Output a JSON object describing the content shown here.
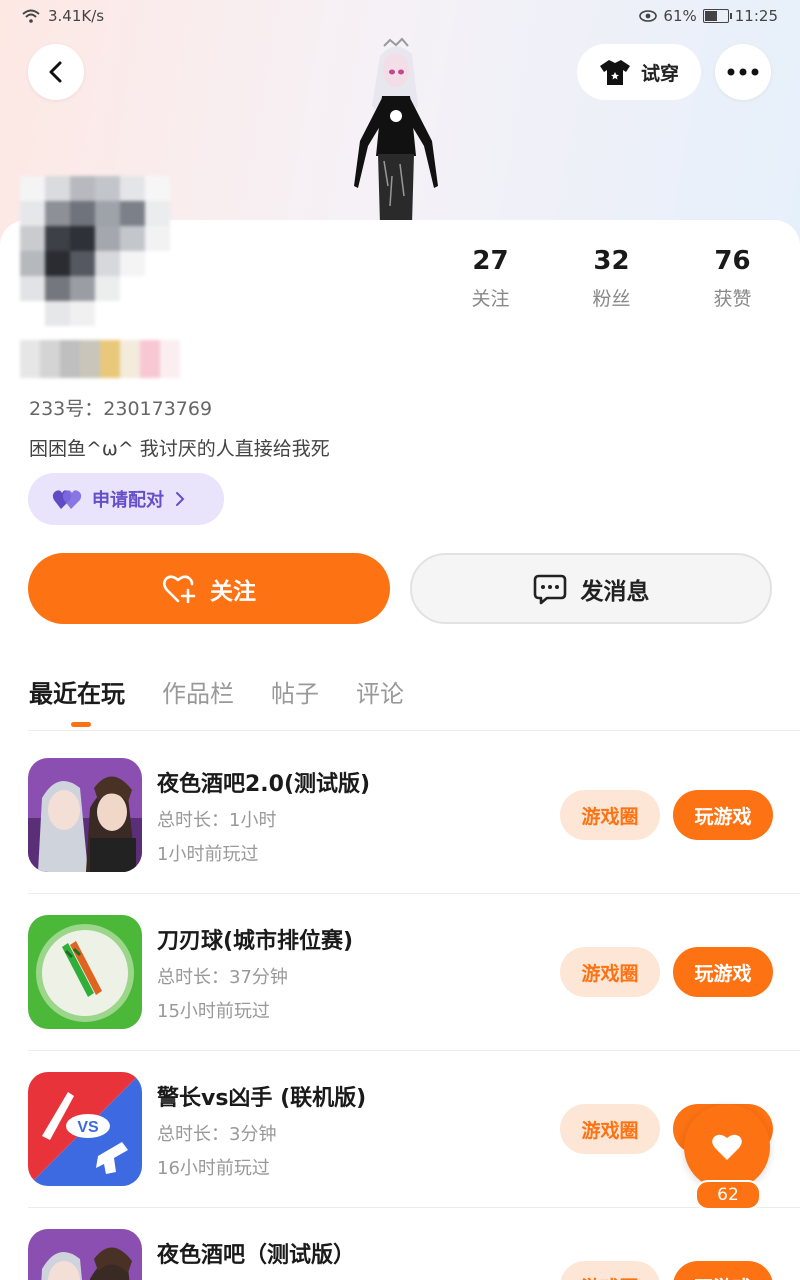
{
  "status_bar": {
    "network_speed": "3.41K/s",
    "battery_percent": "61%",
    "battery_level": 0.61,
    "time": "11:25"
  },
  "header": {
    "try_on_label": "试穿"
  },
  "profile": {
    "stats": [
      {
        "value": "27",
        "label": "关注"
      },
      {
        "value": "32",
        "label": "粉丝"
      },
      {
        "value": "76",
        "label": "获赞"
      }
    ],
    "uid": "233号：230173769",
    "bio": "困困鱼^ω^  我讨厌的人直接给我死",
    "pair_label": "申请配对"
  },
  "actions": {
    "follow_label": "关注",
    "message_label": "发消息"
  },
  "tabs": [
    {
      "label": "最近在玩",
      "active": true
    },
    {
      "label": "作品栏",
      "active": false
    },
    {
      "label": "帖子",
      "active": false
    },
    {
      "label": "评论",
      "active": false
    }
  ],
  "games": [
    {
      "title": "夜色酒吧2.0(测试版)",
      "duration": "总时长：1小时",
      "last_played": "1小时前玩过",
      "circle_label": "游戏圈",
      "play_label": "玩游戏"
    },
    {
      "title": "刀刃球(城市排位赛)",
      "duration": "总时长：37分钟",
      "last_played": "15小时前玩过",
      "circle_label": "游戏圈",
      "play_label": "玩游戏"
    },
    {
      "title": "警长vs凶手 (联机版)",
      "duration": "总时长：3分钟",
      "last_played": "16小时前玩过",
      "circle_label": "游戏圈",
      "play_label": "玩游戏"
    },
    {
      "title": "夜色酒吧（测试版）",
      "duration": "",
      "last_played": "",
      "circle_label": "游戏圈",
      "play_label": "玩游戏"
    }
  ],
  "game_icon_text": {
    "vs": "VS"
  },
  "floating": {
    "like_count": "62"
  },
  "colors": {
    "accent": "#fd7213",
    "accent_light": "#fde6d6",
    "pair_bg": "#e9e3fb",
    "pair_text": "#6450c8"
  }
}
